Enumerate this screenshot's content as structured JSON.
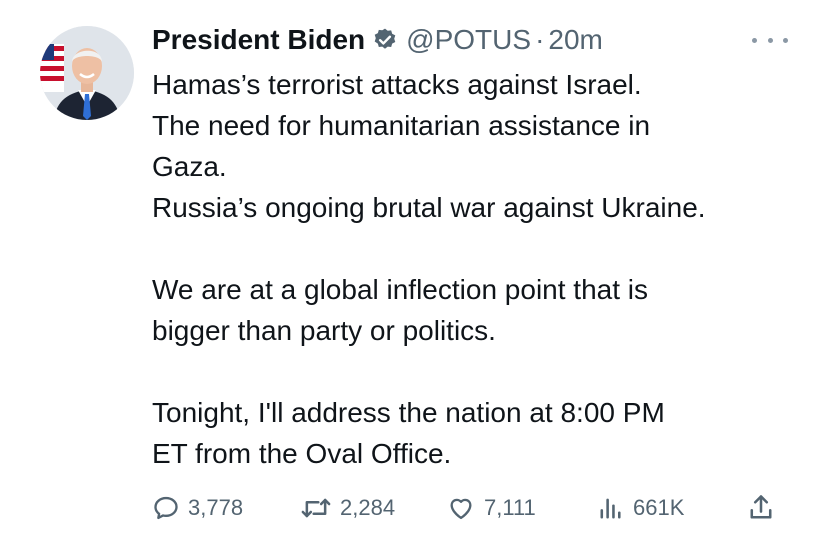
{
  "author": {
    "display_name": "President Biden",
    "handle": "@POTUS",
    "separator": "·",
    "time": "20m",
    "avatar": "avatar-photo",
    "verified_icon": "verified-badge-icon"
  },
  "tweet": {
    "paragraphs": [
      [
        "Hamas’s terrorist attacks against Israel.",
        "The need for humanitarian assistance in",
        "Gaza.",
        "Russia’s ongoing brutal war against Ukraine."
      ],
      [
        "We are at a global inflection point that is",
        "bigger than party or politics."
      ],
      [
        "Tonight, I'll address the nation at 8:00 PM",
        "ET from the Oval Office."
      ]
    ]
  },
  "actions": {
    "replies": "3,778",
    "retweets": "2,284",
    "likes": "7,111",
    "views": "661K"
  },
  "icons": {
    "reply": "reply-icon",
    "retweet": "retweet-icon",
    "like": "heart-icon",
    "views": "views-icon",
    "share": "share-icon",
    "more": "more-icon"
  },
  "colors": {
    "text": "#0f1419",
    "secondary": "#536471",
    "verified_fill": "#536471"
  }
}
